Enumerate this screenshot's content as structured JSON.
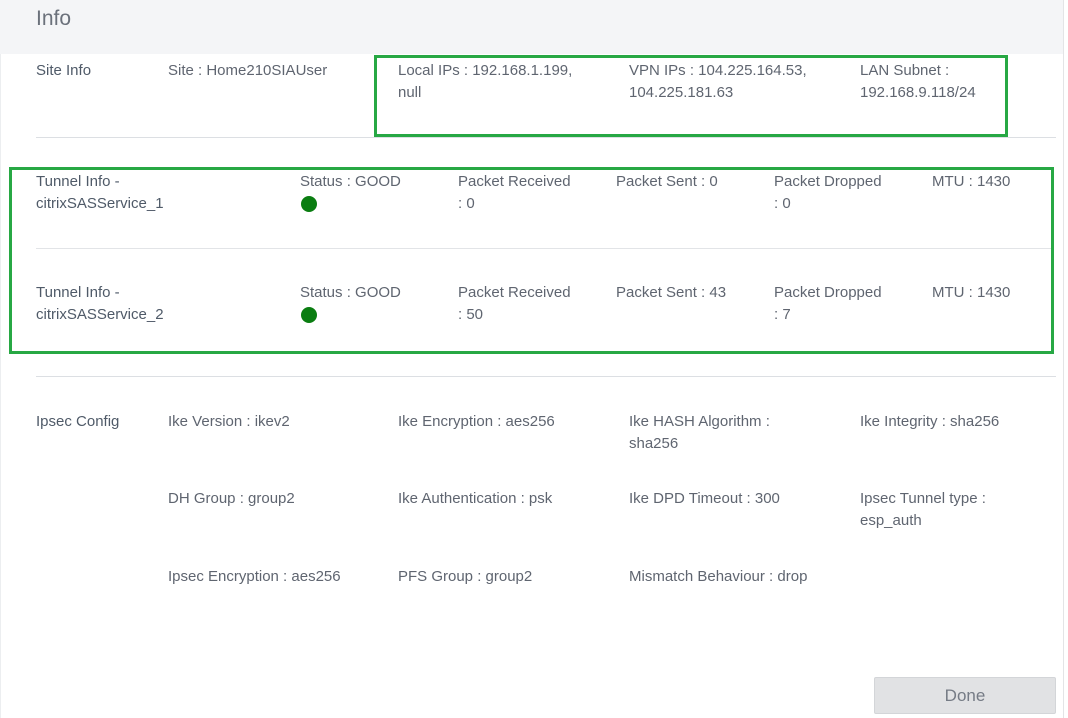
{
  "header": {
    "title": "Info"
  },
  "site_info": {
    "label": "Site Info",
    "site": "Site : Home210SIAUser",
    "local_ips": [
      "Local IPs : 192.168.1.199,",
      "null"
    ],
    "vpn_ips": [
      "VPN IPs : 104.225.164.53,",
      "104.225.181.63"
    ],
    "lan_subnet": [
      "LAN Subnet :",
      "192.168.9.118/24"
    ]
  },
  "tunnels": [
    {
      "label": [
        "Tunnel Info -",
        "citrixSASService_1"
      ],
      "status": "Status : GOOD",
      "status_color": "#0a7d11",
      "packet_received": [
        "Packet Received",
        ": 0"
      ],
      "packet_sent": "Packet Sent : 0",
      "packet_dropped": [
        "Packet Dropped",
        ": 0"
      ],
      "mtu": "MTU : 1430"
    },
    {
      "label": [
        "Tunnel Info -",
        "citrixSASService_2"
      ],
      "status": "Status : GOOD",
      "status_color": "#0a7d11",
      "packet_received": [
        "Packet Received",
        ": 50"
      ],
      "packet_sent": "Packet Sent : 43",
      "packet_dropped": [
        "Packet Dropped",
        ": 7"
      ],
      "mtu": "MTU : 1430"
    }
  ],
  "ipsec": {
    "label": "Ipsec Config",
    "ike_version": "Ike Version : ikev2",
    "ike_encryption": "Ike Encryption : aes256",
    "ike_hash": [
      "Ike HASH Algorithm :",
      "sha256"
    ],
    "ike_integrity": "Ike Integrity : sha256",
    "dh_group": "DH Group : group2",
    "ike_authentication": "Ike Authentication : psk",
    "ike_dpd_timeout": "Ike DPD Timeout : 300",
    "ipsec_tunnel_type": [
      "Ipsec Tunnel type :",
      "esp_auth"
    ],
    "ipsec_encryption": "Ipsec Encryption : aes256",
    "pfs_group": "PFS Group : group2",
    "mismatch_behaviour": "Mismatch Behaviour : drop"
  },
  "footer": {
    "done_label": "Done"
  },
  "colors": {
    "highlight": "#27a844",
    "header_bg": "#f4f5f7"
  }
}
